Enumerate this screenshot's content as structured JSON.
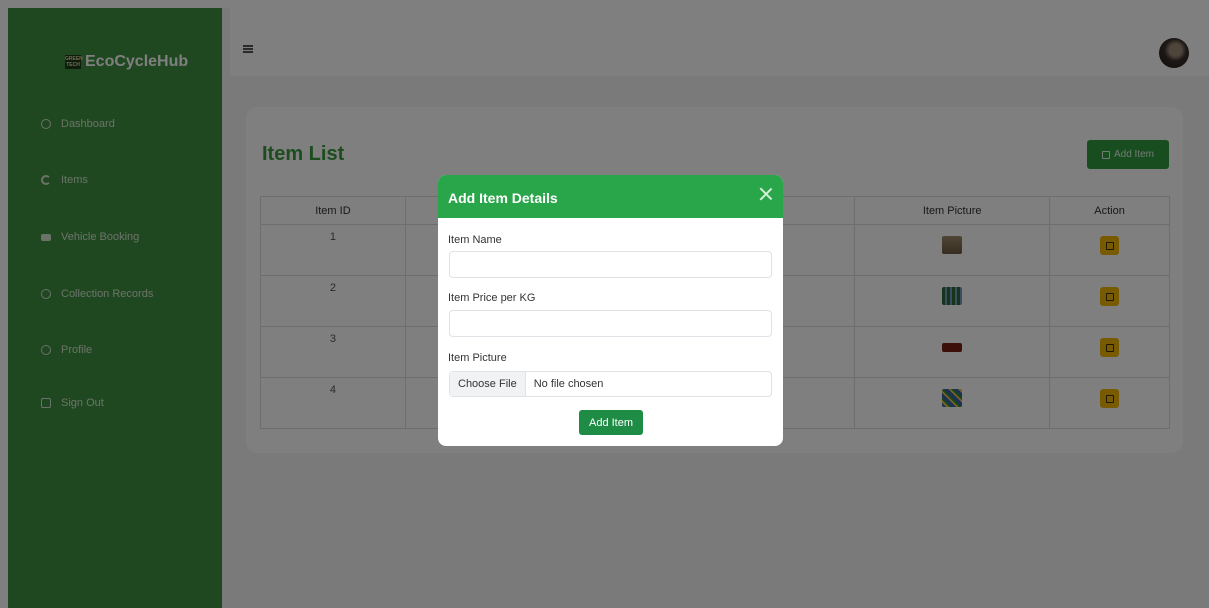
{
  "brand": {
    "logo_text": "GREEN TECH",
    "name": "EcoCycleHub"
  },
  "sidebar": {
    "items": [
      {
        "label": "Dashboard",
        "icon": "dashboard-icon"
      },
      {
        "label": "Items",
        "icon": "items-icon"
      },
      {
        "label": "Vehicle Booking",
        "icon": "truck-icon"
      },
      {
        "label": "Collection Records",
        "icon": "records-icon"
      },
      {
        "label": "Profile",
        "icon": "profile-icon"
      },
      {
        "label": "Sign Out",
        "icon": "sign-out-icon"
      }
    ]
  },
  "main": {
    "title": "Item List",
    "add_button_label": "Add Item",
    "table": {
      "columns": [
        "Item ID",
        "Item Picture",
        "Action"
      ],
      "rows": [
        {
          "id": "1",
          "picture": "cardboard-box-image"
        },
        {
          "id": "2",
          "picture": "bottles-image"
        },
        {
          "id": "3",
          "picture": "red-container-image"
        },
        {
          "id": "4",
          "picture": "mixed-recyclables-image"
        }
      ]
    }
  },
  "modal": {
    "title": "Add Item Details",
    "fields": {
      "name_label": "Item Name",
      "name_value": "",
      "price_label": "Item Price per KG",
      "price_value": "",
      "picture_label": "Item Picture",
      "file_button": "Choose File",
      "file_status": "No file chosen"
    },
    "submit_label": "Add Item"
  },
  "colors": {
    "sidebar": "#3f9140",
    "title_green": "#3a9a3c",
    "modal_header": "#2aa64a",
    "edit_button": "#f0b600"
  }
}
